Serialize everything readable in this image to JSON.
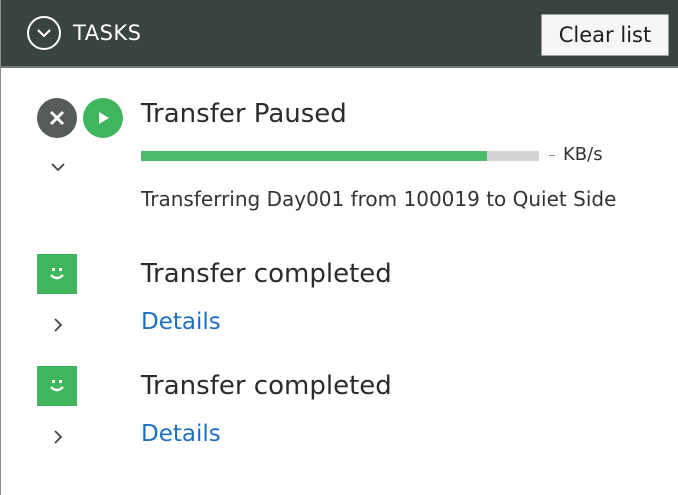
{
  "header": {
    "title": "TASKS",
    "clear_label": "Clear list",
    "collapse_icon": "chevron-down-circle-icon"
  },
  "colors": {
    "header_bg": "#3a443e",
    "success_green": "#3fb55d",
    "progress_fill": "#4cbb6a",
    "progress_track": "#d4d4d4",
    "cancel_gray": "#555b57",
    "link_blue": "#1f6fc0"
  },
  "tasks": [
    {
      "title": "Transfer Paused",
      "progress": 0.87,
      "speed_unit": "KB/s",
      "detail": "Transferring Day001 from 100019 to Quiet Side",
      "icons": [
        "cancel-icon",
        "play-icon"
      ],
      "expanded": true
    },
    {
      "title": "Transfer completed",
      "link_label": "Details",
      "icons": [
        "smiley-icon"
      ],
      "expanded": false
    },
    {
      "title": "Transfer completed",
      "link_label": "Details",
      "icons": [
        "smiley-icon"
      ],
      "expanded": false
    }
  ]
}
